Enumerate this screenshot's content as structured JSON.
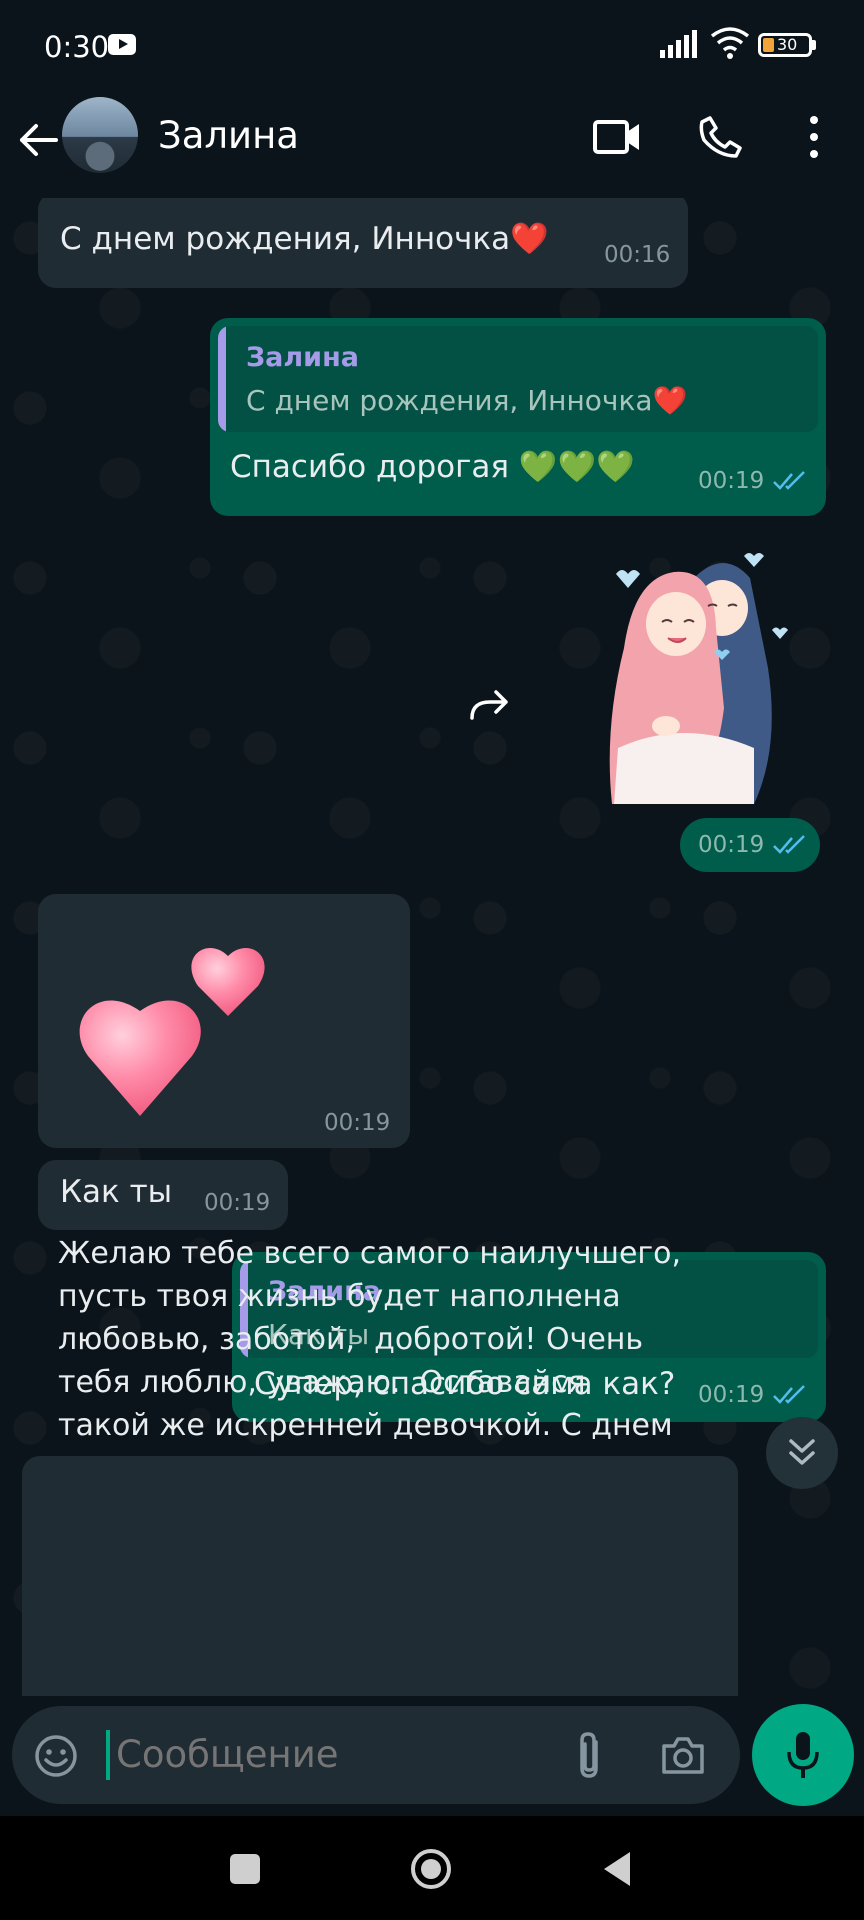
{
  "status_bar": {
    "time": "0:30",
    "battery": "30"
  },
  "header": {
    "contact_name": "Залина"
  },
  "messages": [
    {
      "dir": "in",
      "text": "С днем рождения,  Инночка❤️",
      "time": "00:16"
    },
    {
      "dir": "out",
      "quote_author": "Залина",
      "quote_text": "С днем рождения,  Инночка❤️",
      "text": "Спасибо дорогая 💚💚💚",
      "time": "00:19"
    },
    {
      "dir": "out",
      "type": "sticker",
      "time": "00:19"
    },
    {
      "dir": "in",
      "type": "sticker",
      "time": "00:19"
    },
    {
      "dir": "in",
      "text": "Как ты",
      "time": "00:19"
    },
    {
      "dir": "out",
      "quote_author": "Залина",
      "quote_text": "Как ты",
      "text": "Супер, спасибо сама как?",
      "time": "00:19"
    },
    {
      "dir": "in",
      "text": "Желаю тебе всего самого наилучшего,\nпусть твоя жизнь будет наполнена\nлюбовью, заботой,  добротой! Очень\nтебя люблю, уважаю.  Оставайся\nтакой же искренней девочкой. С днем"
    }
  ],
  "composer": {
    "placeholder": "Сообщение"
  },
  "colors": {
    "incoming": "#202c33",
    "outgoing": "#005c4b",
    "accent": "#00a884",
    "quote_author": "#a59be8"
  },
  "icons": [
    "back-arrow-icon",
    "video-call-icon",
    "phone-icon",
    "more-vert-icon",
    "forward-icon",
    "read-ticks-icon",
    "chevron-double-down-icon",
    "emoji-icon",
    "attach-icon",
    "camera-icon",
    "mic-icon"
  ]
}
